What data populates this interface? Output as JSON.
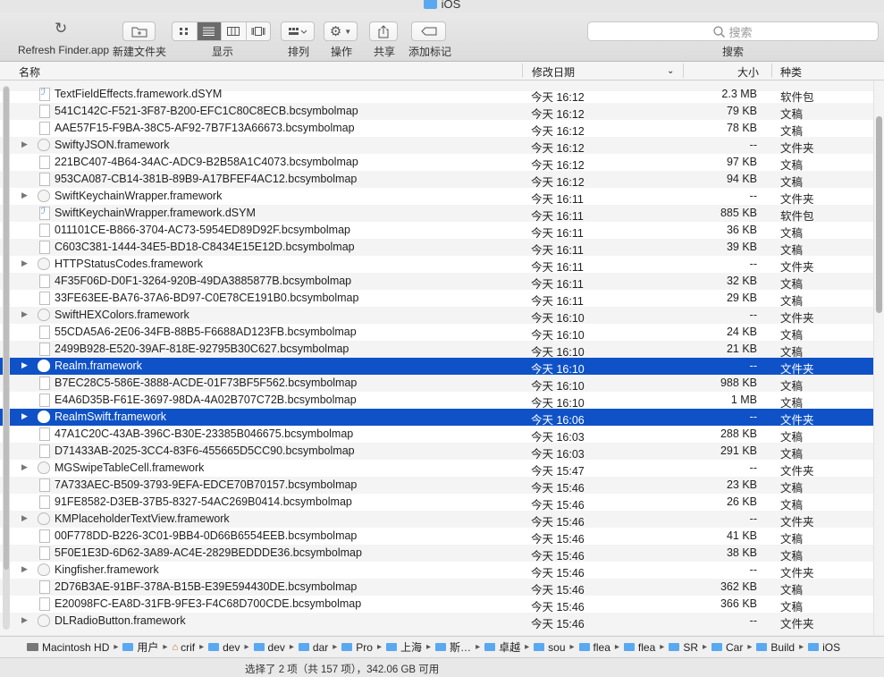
{
  "window": {
    "title": "iOS"
  },
  "toolbar": {
    "refresh_label": "Refresh Finder.app",
    "new_folder_label": "新建文件夹",
    "view_label": "显示",
    "arrange_label": "排列",
    "action_label": "操作",
    "share_label": "共享",
    "tag_label": "添加标记",
    "search_placeholder": "搜索",
    "search_label": "搜索"
  },
  "columns": {
    "name": "名称",
    "date": "修改日期",
    "size": "大小",
    "kind": "种类"
  },
  "rows": [
    {
      "name": "TextFieldEffects.framework.dSYM",
      "date": "今天 16:12",
      "size": "2.3 MB",
      "kind": "软件包",
      "type": "dsym",
      "disclosure": false,
      "selected": false
    },
    {
      "name": "541C142C-F521-3F87-B200-EFC1C80C8ECB.bcsymbolmap",
      "date": "今天 16:12",
      "size": "79 KB",
      "kind": "文稿",
      "type": "doc",
      "disclosure": false,
      "selected": false
    },
    {
      "name": "AAE57F15-F9BA-38C5-AF92-7B7F13A66673.bcsymbolmap",
      "date": "今天 16:12",
      "size": "78 KB",
      "kind": "文稿",
      "type": "doc",
      "disclosure": false,
      "selected": false
    },
    {
      "name": "SwiftyJSON.framework",
      "date": "今天 16:12",
      "size": "--",
      "kind": "文件夹",
      "type": "fw",
      "disclosure": true,
      "selected": false
    },
    {
      "name": "221BC407-4B64-34AC-ADC9-B2B58A1C4073.bcsymbolmap",
      "date": "今天 16:12",
      "size": "97 KB",
      "kind": "文稿",
      "type": "doc",
      "disclosure": false,
      "selected": false
    },
    {
      "name": "953CA087-CB14-381B-89B9-A17BFEF4AC12.bcsymbolmap",
      "date": "今天 16:12",
      "size": "94 KB",
      "kind": "文稿",
      "type": "doc",
      "disclosure": false,
      "selected": false
    },
    {
      "name": "SwiftKeychainWrapper.framework",
      "date": "今天 16:11",
      "size": "--",
      "kind": "文件夹",
      "type": "fw",
      "disclosure": true,
      "selected": false
    },
    {
      "name": "SwiftKeychainWrapper.framework.dSYM",
      "date": "今天 16:11",
      "size": "885 KB",
      "kind": "软件包",
      "type": "dsym",
      "disclosure": false,
      "selected": false
    },
    {
      "name": "011101CE-B866-3704-AC73-5954ED89D92F.bcsymbolmap",
      "date": "今天 16:11",
      "size": "36 KB",
      "kind": "文稿",
      "type": "doc",
      "disclosure": false,
      "selected": false
    },
    {
      "name": "C603C381-1444-34E5-BD18-C8434E15E12D.bcsymbolmap",
      "date": "今天 16:11",
      "size": "39 KB",
      "kind": "文稿",
      "type": "doc",
      "disclosure": false,
      "selected": false
    },
    {
      "name": "HTTPStatusCodes.framework",
      "date": "今天 16:11",
      "size": "--",
      "kind": "文件夹",
      "type": "fw",
      "disclosure": true,
      "selected": false
    },
    {
      "name": "4F35F06D-D0F1-3264-920B-49DA3885877B.bcsymbolmap",
      "date": "今天 16:11",
      "size": "32 KB",
      "kind": "文稿",
      "type": "doc",
      "disclosure": false,
      "selected": false
    },
    {
      "name": "33FE63EE-BA76-37A6-BD97-C0E78CE191B0.bcsymbolmap",
      "date": "今天 16:11",
      "size": "29 KB",
      "kind": "文稿",
      "type": "doc",
      "disclosure": false,
      "selected": false
    },
    {
      "name": "SwiftHEXColors.framework",
      "date": "今天 16:10",
      "size": "--",
      "kind": "文件夹",
      "type": "fw",
      "disclosure": true,
      "selected": false
    },
    {
      "name": "55CDA5A6-2E06-34FB-88B5-F6688AD123FB.bcsymbolmap",
      "date": "今天 16:10",
      "size": "24 KB",
      "kind": "文稿",
      "type": "doc",
      "disclosure": false,
      "selected": false
    },
    {
      "name": "2499B928-E520-39AF-818E-92795B30C627.bcsymbolmap",
      "date": "今天 16:10",
      "size": "21 KB",
      "kind": "文稿",
      "type": "doc",
      "disclosure": false,
      "selected": false
    },
    {
      "name": "Realm.framework",
      "date": "今天 16:10",
      "size": "--",
      "kind": "文件夹",
      "type": "fw",
      "disclosure": true,
      "selected": true
    },
    {
      "name": "B7EC28C5-586E-3888-ACDE-01F73BF5F562.bcsymbolmap",
      "date": "今天 16:10",
      "size": "988 KB",
      "kind": "文稿",
      "type": "doc",
      "disclosure": false,
      "selected": false
    },
    {
      "name": "E4A6D35B-F61E-3697-98DA-4A02B707C72B.bcsymbolmap",
      "date": "今天 16:10",
      "size": "1 MB",
      "kind": "文稿",
      "type": "doc",
      "disclosure": false,
      "selected": false
    },
    {
      "name": "RealmSwift.framework",
      "date": "今天 16:06",
      "size": "--",
      "kind": "文件夹",
      "type": "fw",
      "disclosure": true,
      "selected": true
    },
    {
      "name": "47A1C20C-43AB-396C-B30E-23385B046675.bcsymbolmap",
      "date": "今天 16:03",
      "size": "288 KB",
      "kind": "文稿",
      "type": "doc",
      "disclosure": false,
      "selected": false
    },
    {
      "name": "D71433AB-2025-3CC4-83F6-455665D5CC90.bcsymbolmap",
      "date": "今天 16:03",
      "size": "291 KB",
      "kind": "文稿",
      "type": "doc",
      "disclosure": false,
      "selected": false
    },
    {
      "name": "MGSwipeTableCell.framework",
      "date": "今天 15:47",
      "size": "--",
      "kind": "文件夹",
      "type": "fw",
      "disclosure": true,
      "selected": false
    },
    {
      "name": "7A733AEC-B509-3793-9EFA-EDCE70B70157.bcsymbolmap",
      "date": "今天 15:46",
      "size": "23 KB",
      "kind": "文稿",
      "type": "doc",
      "disclosure": false,
      "selected": false
    },
    {
      "name": "91FE8582-D3EB-37B5-8327-54AC269B0414.bcsymbolmap",
      "date": "今天 15:46",
      "size": "26 KB",
      "kind": "文稿",
      "type": "doc",
      "disclosure": false,
      "selected": false
    },
    {
      "name": "KMPlaceholderTextView.framework",
      "date": "今天 15:46",
      "size": "--",
      "kind": "文件夹",
      "type": "fw",
      "disclosure": true,
      "selected": false
    },
    {
      "name": "00F778DD-B226-3C01-9BB4-0D66B6554EEB.bcsymbolmap",
      "date": "今天 15:46",
      "size": "41 KB",
      "kind": "文稿",
      "type": "doc",
      "disclosure": false,
      "selected": false
    },
    {
      "name": "5F0E1E3D-6D62-3A89-AC4E-2829BEDDDE36.bcsymbolmap",
      "date": "今天 15:46",
      "size": "38 KB",
      "kind": "文稿",
      "type": "doc",
      "disclosure": false,
      "selected": false
    },
    {
      "name": "Kingfisher.framework",
      "date": "今天 15:46",
      "size": "--",
      "kind": "文件夹",
      "type": "fw",
      "disclosure": true,
      "selected": false
    },
    {
      "name": "2D76B3AE-91BF-378A-B15B-E39E594430DE.bcsymbolmap",
      "date": "今天 15:46",
      "size": "362 KB",
      "kind": "文稿",
      "type": "doc",
      "disclosure": false,
      "selected": false
    },
    {
      "name": "E20098FC-EA8D-31FB-9FE3-F4C68D700CDE.bcsymbolmap",
      "date": "今天 15:46",
      "size": "366 KB",
      "kind": "文稿",
      "type": "doc",
      "disclosure": false,
      "selected": false
    },
    {
      "name": "DLRadioButton.framework",
      "date": "今天 15:46",
      "size": "--",
      "kind": "文件夹",
      "type": "fw",
      "disclosure": true,
      "selected": false
    }
  ],
  "pathbar": [
    {
      "label": "Macintosh HD",
      "type": "disk"
    },
    {
      "label": "用户",
      "type": "folder"
    },
    {
      "label": "crif",
      "type": "home"
    },
    {
      "label": "dev",
      "type": "folder"
    },
    {
      "label": "dev",
      "type": "folder"
    },
    {
      "label": "dar",
      "type": "folder"
    },
    {
      "label": "Pro",
      "type": "folder"
    },
    {
      "label": "上海",
      "type": "folder"
    },
    {
      "label": "斯…",
      "type": "folder"
    },
    {
      "label": "卓越",
      "type": "folder"
    },
    {
      "label": "sou",
      "type": "folder"
    },
    {
      "label": "flea",
      "type": "folder"
    },
    {
      "label": "flea",
      "type": "folder"
    },
    {
      "label": "SR",
      "type": "folder"
    },
    {
      "label": "Car",
      "type": "folder"
    },
    {
      "label": "Build",
      "type": "folder"
    },
    {
      "label": "iOS",
      "type": "folder"
    }
  ],
  "status": {
    "text": "选择了 2 项（共 157 项），342.06 GB 可用"
  },
  "colors": {
    "selection": "#0f52c7",
    "folder": "#5aa9f0"
  }
}
